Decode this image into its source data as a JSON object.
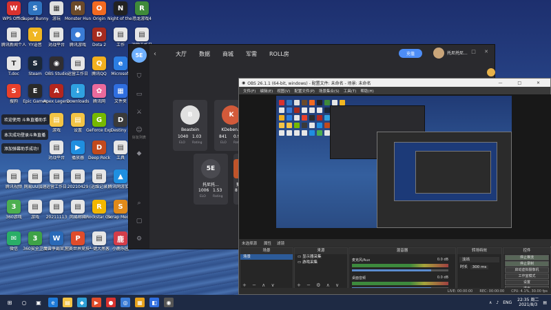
{
  "desktop": {
    "icons": [
      {
        "label": "WPS Office",
        "glyph": "W",
        "color": "#d8322f"
      },
      {
        "label": "Super Bunnyball",
        "glyph": "S",
        "color": "#2f74c0"
      },
      {
        "label": "游玩",
        "glyph": "▦",
        "color": "#e0e0e0"
      },
      {
        "label": "Monster Hunter",
        "glyph": "M",
        "color": "#6b4a2a"
      },
      {
        "label": "Origin",
        "glyph": "O",
        "color": "#f26a21"
      },
      {
        "label": "Night of the Dead",
        "glyph": "N",
        "color": "#222"
      },
      {
        "label": "恐龙游戏4",
        "glyph": "R",
        "color": "#3f8a3a"
      },
      {
        "label": "腾讯新闻个人",
        "glyph": "▤",
        "color": "#e6e6e6"
      },
      {
        "label": "YY语音",
        "glyph": "Y",
        "color": "#f0b622"
      },
      {
        "label": "对战平台",
        "glyph": "▤",
        "color": "#e6e6e6"
      },
      {
        "label": "腾讯游戏",
        "glyph": "●",
        "color": "#3a7bd5"
      },
      {
        "label": "Dota 2",
        "glyph": "D",
        "color": "#a52b1f"
      },
      {
        "label": "工作",
        "glyph": "▤",
        "color": "#e6e6e6"
      },
      {
        "label": "运营工作日",
        "glyph": "▤",
        "color": "#e6e6e6"
      },
      {
        "label": "T.doc",
        "glyph": "T",
        "color": "#e6e6e6"
      },
      {
        "label": "Steam",
        "glyph": "S",
        "color": "#1b2838"
      },
      {
        "label": "OBS Studio",
        "glyph": "◉",
        "color": "#302e31"
      },
      {
        "label": "运营工作日",
        "glyph": "▤",
        "color": "#e6e6e6"
      },
      {
        "label": "腾讯QQ",
        "glyph": "Q",
        "color": "#f2b01e"
      },
      {
        "label": "Microsoft",
        "glyph": "e",
        "color": "#2b7de1"
      },
      {
        "label": "斗鱼直播",
        "glyph": "▤",
        "color": "#e6e6e6"
      },
      {
        "label": "搜狗",
        "glyph": "S",
        "color": "#e8402b"
      },
      {
        "label": "Epic Games",
        "glyph": "E",
        "color": "#2a2a2a"
      },
      {
        "label": "Apex Legends",
        "glyph": "A",
        "color": "#b3261e"
      },
      {
        "label": "Downloads",
        "glyph": "↓",
        "color": "#2fa1e0"
      },
      {
        "label": "腾讯网",
        "glyph": "✿",
        "color": "#ea6a9c"
      },
      {
        "label": "文件夹",
        "glyph": "▦",
        "color": "#2f6ee0"
      },
      {
        "label": "游戏",
        "glyph": "▤",
        "color": "#f3c445"
      },
      {
        "label": "设置",
        "glyph": "▤",
        "color": "#f3c445"
      },
      {
        "label": "GeForce Experience",
        "glyph": "G",
        "color": "#76b900"
      },
      {
        "label": "Destiny 2",
        "glyph": "D",
        "color": "#3a3a3a"
      },
      {
        "label": "对战平台",
        "glyph": "▤",
        "color": "#e6e6e6"
      },
      {
        "label": "播放器",
        "glyph": "▶",
        "color": "#1f8fe0"
      },
      {
        "label": "Deep Rock",
        "glyph": "D",
        "color": "#c14a1d"
      },
      {
        "label": "工具",
        "glyph": "▤",
        "color": "#e6e6e6"
      },
      {
        "label": "腾讯视频",
        "glyph": "▤",
        "color": "#e6e6e6"
      },
      {
        "label": "网易UU加速",
        "glyph": "▤",
        "color": "#e6e6e6"
      },
      {
        "label": "运营工作日",
        "glyph": "▤",
        "color": "#e6e6e6"
      },
      {
        "label": "20210429",
        "glyph": "▤",
        "color": "#e6e6e6"
      },
      {
        "label": "(运维记录)",
        "glyph": "▤",
        "color": "#e6e6e6"
      },
      {
        "label": "腾讯网游加速",
        "glyph": "▲",
        "color": "#1f8fe0"
      },
      {
        "label": "360游戏",
        "glyph": "3",
        "color": "#4caf50"
      },
      {
        "label": "游戏",
        "glyph": "▤",
        "color": "#e6e6e6"
      },
      {
        "label": "20211113",
        "glyph": "▤",
        "color": "#e6e6e6"
      },
      {
        "label": "网易邮箱",
        "glyph": "▤",
        "color": "#e6e6e6"
      },
      {
        "label": "Rockstar Games",
        "glyph": "R",
        "color": "#f2b700"
      },
      {
        "label": "Scrap Mechanic",
        "glyph": "S",
        "color": "#e08a1a"
      },
      {
        "label": "微信",
        "glyph": "✉",
        "color": "#2aae67"
      },
      {
        "label": "360安全卫士",
        "glyph": "3",
        "color": "#3ea247"
      },
      {
        "label": "魔兽争霸官方对战平台",
        "glyph": "W",
        "color": "#2a6ab8"
      },
      {
        "label": "完美世界竞技平台",
        "glyph": "P",
        "color": "#e04c2b"
      },
      {
        "label": "一键大黑客",
        "glyph": "▤",
        "color": "#e6e6e6"
      },
      {
        "label": "小鹿乐园",
        "glyph": "鹿",
        "color": "#d43d4a"
      }
    ],
    "tooltip_1": "欢迎使用 斗鱼直播助手",
    "tooltip_2": "本次成功登录斗鱼直播",
    "tooltip_3": "添加弹幕助手成功!"
  },
  "app": {
    "logo": "5E",
    "nav": [
      "大厅",
      "数据",
      "商城",
      "军需",
      "ROLL房"
    ],
    "recharge_label": "充值",
    "username": "托尼托尼...",
    "rail_label": "好友列表",
    "players": [
      {
        "name": "Beastein",
        "elo": "1040",
        "rating": "1.03",
        "face": "B",
        "color": "#e0e0e0"
      },
      {
        "name": "KDeben...",
        "elo": "841",
        "rating": "0.95",
        "face": "K",
        "color": "#d25a3a"
      },
      {
        "name": "托尼托...",
        "elo": "1006",
        "rating": "1.53",
        "face": "5E",
        "color": "#4a4a50"
      },
      {
        "name": "葵",
        "elo": "8",
        "rating": "",
        "face": "",
        "color": "#c0542a"
      }
    ],
    "elo_label": "ELO",
    "rating_label": "Rating"
  },
  "obs": {
    "title": "OBS 26.1.1 (64-bit, windows) - 配置文件: 未命名 - 场景: 未命名",
    "menu": [
      "文件(F)",
      "编辑(E)",
      "视图(V)",
      "配置文件(P)",
      "场景集合(S)",
      "工具(T)",
      "帮助(H)"
    ],
    "mode_left": "未选择源",
    "mode_props": "属性",
    "mode_filters": "滤镜",
    "scenes": {
      "title": "场景",
      "items": [
        "场景"
      ]
    },
    "sources": {
      "title": "来源",
      "items": [
        "显示器采集",
        "游戏采集"
      ]
    },
    "mixer": {
      "title": "混音器",
      "channels": [
        {
          "name": "麦克风/Aux",
          "db": "0.0 dB",
          "level": 0.82
        },
        {
          "name": "桌面音频",
          "db": "0.0 dB",
          "level": 0.82
        }
      ]
    },
    "transitions": {
      "title": "转场特效",
      "type": "淡出",
      "duration_label": "时长",
      "duration_value": "300 ms"
    },
    "controls": {
      "title": "控件",
      "buttons": [
        "停止推流",
        "停止录制",
        "启动虚拟摄像机",
        "工作室模式",
        "设置",
        "退出"
      ],
      "active_count": 2
    },
    "status": {
      "live": "LIVE: 00:00:00",
      "rec": "REC: 00:00:00",
      "cpu": "CPU: 4.1%, 30.00 fps"
    }
  },
  "taskbar": {
    "icons": [
      "⊞",
      "○",
      "▣",
      "e",
      "▤",
      "◆",
      "▶",
      "●",
      "◎",
      "▦",
      "◧",
      "◉"
    ],
    "lang": "ENG",
    "time": "22:35 周二",
    "date": "2021/8/3"
  }
}
